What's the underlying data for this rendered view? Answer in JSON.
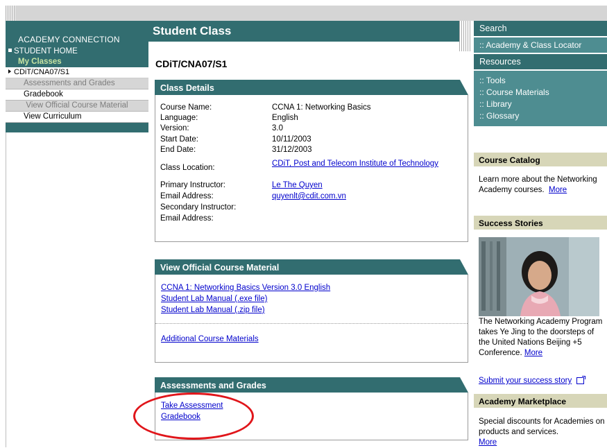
{
  "left_nav": {
    "title": "ACADEMY CONNECTION",
    "home": "STUDENT HOME",
    "my_classes": "My Classes",
    "class_code": "CDiT/CNA07/S1",
    "items": [
      {
        "label": "Assessments and Grades",
        "state": "disabled"
      },
      {
        "label": "Gradebook",
        "state": "active"
      },
      {
        "label": "View Official Course Material",
        "state": "disabled"
      },
      {
        "label": "View Curriculum",
        "state": "active"
      }
    ]
  },
  "main": {
    "page_title": "Student Class",
    "class_code": "CDiT/CNA07/S1",
    "class_details": {
      "heading": "Class Details",
      "rows": [
        {
          "label": "Course Name:",
          "value": "CCNA 1: Networking Basics",
          "link": false
        },
        {
          "label": "Language:",
          "value": "English",
          "link": false
        },
        {
          "label": "Version:",
          "value": "3.0",
          "link": false
        },
        {
          "label": "Start Date:",
          "value": "10/11/2003",
          "link": false
        },
        {
          "label": "End Date:",
          "value": "31/12/2003",
          "link": false
        },
        {
          "label": "Class Location:",
          "value": "CDiT, Post and Telecom Institute of Technology",
          "link": true
        },
        {
          "label": "Primary Instructor:",
          "value": "Le The Quyen",
          "link": true
        },
        {
          "label": "Email Address:",
          "value": "quyenlt@cdit.com.vn",
          "link": true
        },
        {
          "label": "Secondary Instructor:",
          "value": "",
          "link": false
        },
        {
          "label": "Email Address:",
          "value": "",
          "link": false
        }
      ]
    },
    "course_material": {
      "heading": "View Official Course Material",
      "links": [
        "CCNA 1: Networking Basics Version 3.0 English",
        "Student Lab Manual (.exe file)",
        "Student Lab Manual (.zip file)"
      ],
      "additional": "Additional Course Materials"
    },
    "assessments": {
      "heading": "Assessments and Grades",
      "links": [
        "Take Assessment",
        "Gradebook"
      ]
    }
  },
  "right": {
    "search_title": "Search",
    "locator": ":: Academy & Class Locator",
    "resources_title": "Resources",
    "resource_links": [
      ":: Tools",
      ":: Course Materials",
      ":: Library",
      ":: Glossary"
    ],
    "catalog": {
      "heading": "Course Catalog",
      "text": "Learn more about the Networking Academy courses.",
      "more": "More"
    },
    "success": {
      "heading": "Success Stories",
      "text": "The Networking Academy Program takes Ye Jing to the doorsteps of the United Nations Beijing +5 Conference.",
      "more": "More",
      "submit": "Submit your success story"
    },
    "marketplace": {
      "heading": "Academy Marketplace",
      "text": "Special discounts for Academies on products and services.",
      "more": "More"
    }
  },
  "colors": {
    "teal": "#326d70",
    "teal_light": "#4e8d91",
    "tan": "#d7d6b8",
    "highlight_circle": "#e0151a"
  }
}
